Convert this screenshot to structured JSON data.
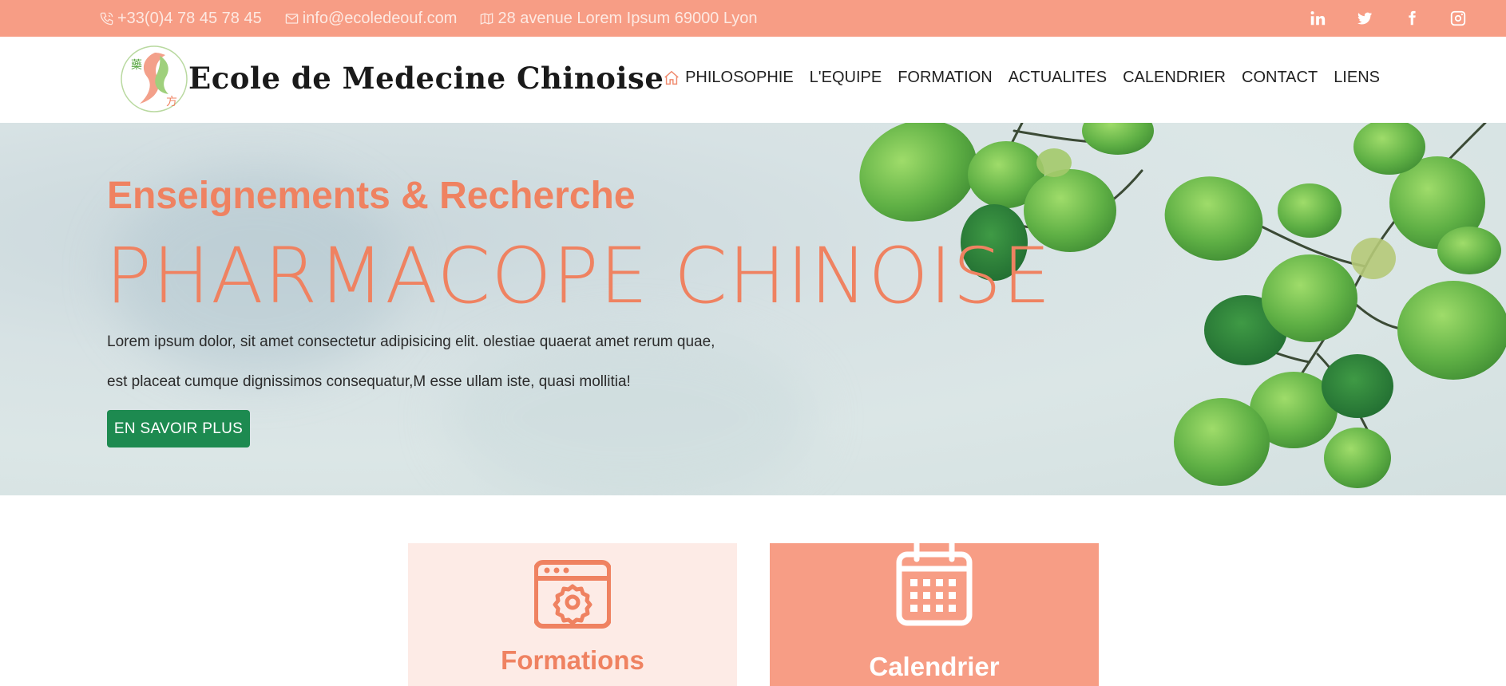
{
  "topbar": {
    "phone": "+33(0)4 78 45 78 45",
    "email": "info@ecoledeouf.com",
    "address": "28 avenue Lorem Ipsum 69000 Lyon",
    "social": [
      "linkedin-icon",
      "twitter-icon",
      "facebook-icon",
      "instagram-icon"
    ]
  },
  "header": {
    "logo_text": "Ecole de Medecine Chinoise",
    "nav": [
      "PHILOSOPHIE",
      "L'EQUIPE",
      "FORMATION",
      "ACTUALITES",
      "CALENDRIER",
      "CONTACT",
      "LIENS"
    ]
  },
  "hero": {
    "subtitle": "Enseignements & Recherche",
    "title": "PHARMACOPE CHINOISE",
    "text_line1": "Lorem ipsum dolor, sit amet consectetur adipisicing elit. olestiae quaerat amet rerum quae,",
    "text_line2": "est placeat cumque dignissimos consequatur,M esse ullam iste, quasi mollitia!",
    "button": "EN SAVOIR PLUS"
  },
  "cards": {
    "formations": "Formations",
    "calendrier": "Calendrier"
  },
  "colors": {
    "accent": "#ef8261",
    "topbar": "#f79d85",
    "button": "#1d8a50",
    "card_light": "#fdebe6",
    "leaf": "#5aa843"
  }
}
